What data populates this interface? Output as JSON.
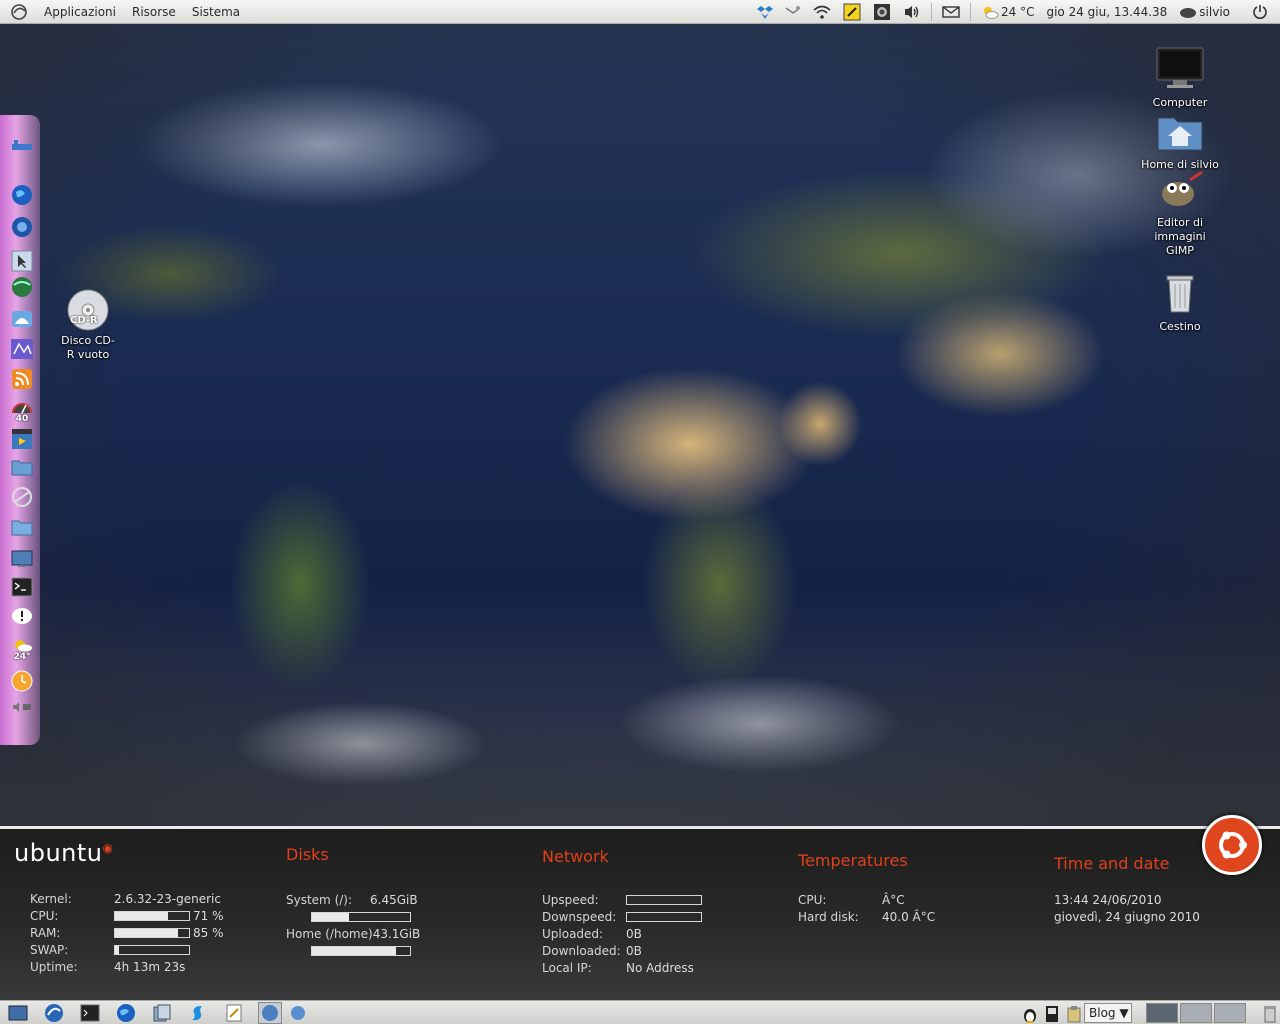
{
  "top_panel": {
    "menus": [
      "Applicazioni",
      "Risorse",
      "Sistema"
    ],
    "weather": "24 °C",
    "clock": "gio 24 giu, 13.44.38",
    "user": "silvio"
  },
  "desktop_icons": [
    {
      "label": "Computer",
      "icon": "monitor-icon"
    },
    {
      "label": "Home di silvio",
      "icon": "home-folder-icon"
    },
    {
      "label": "Editor di immagini GIMP",
      "icon": "gimp-icon"
    },
    {
      "label": "Cestino",
      "icon": "trash-icon"
    },
    {
      "label": "Disco CD-R vuoto",
      "icon": "cdr-disc-icon",
      "badge": "CD-R"
    }
  ],
  "dock": {
    "gauge_value": "40",
    "weather_value": "24°"
  },
  "conky": {
    "brand": "ubuntu",
    "system": {
      "rows": [
        {
          "label": "Kernel:",
          "value": "2.6.32-23-generic"
        },
        {
          "label": "CPU:",
          "value": "71 %",
          "percent": 71
        },
        {
          "label": "RAM:",
          "value": "85 %",
          "percent": 85
        },
        {
          "label": "SWAP:",
          "value": "",
          "percent": 5
        },
        {
          "label": "Uptime:",
          "value": "4h 13m 23s"
        }
      ]
    },
    "disks": {
      "title": "Disks",
      "rows": [
        {
          "label": "System (/):",
          "value": "6.45GiB",
          "percent": 38
        },
        {
          "label": "Home (/home)",
          "value": "43.1GiB",
          "percent": 86
        }
      ]
    },
    "network": {
      "title": "Network",
      "rows": [
        {
          "label": "Upspeed:",
          "value": "",
          "percent": 0
        },
        {
          "label": "Downspeed:",
          "value": "",
          "percent": 0
        },
        {
          "label": "Uploaded:",
          "value": "0B"
        },
        {
          "label": "Downloaded:",
          "value": "0B"
        },
        {
          "label": "Local IP:",
          "value": "No Address"
        }
      ]
    },
    "temperatures": {
      "title": "Temperatures",
      "rows": [
        {
          "label": "CPU:",
          "value": "Â°C"
        },
        {
          "label": "Hard disk:",
          "value": "40.0 Â°C"
        }
      ]
    },
    "time": {
      "title": "Time and date",
      "line1": "13:44  24/06/2010",
      "line2": "giovedì, 24 giugno 2010"
    }
  },
  "bottom_panel": {
    "blog_label": "Blog ▼"
  },
  "colors": {
    "accent": "#e0401a",
    "panel": "#dcdcd8"
  }
}
